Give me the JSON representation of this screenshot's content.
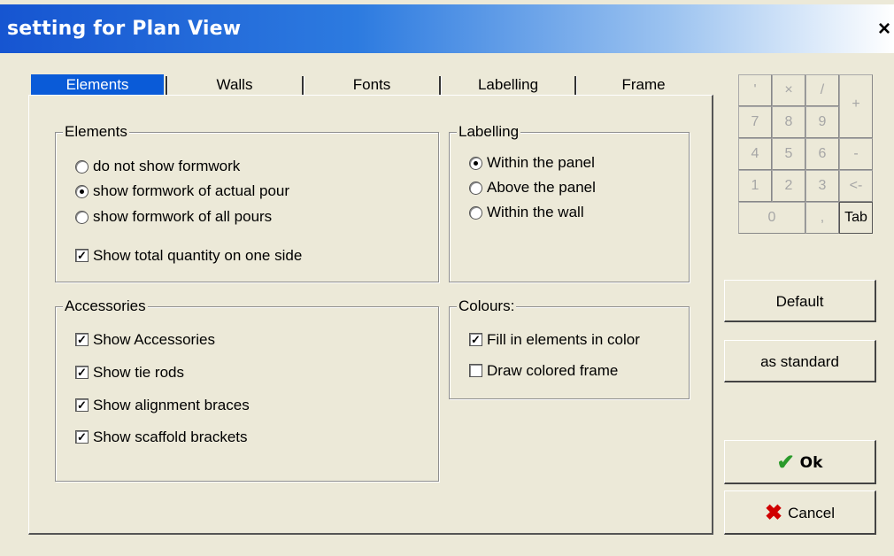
{
  "window": {
    "title": "setting for Plan View",
    "close_glyph": "×"
  },
  "tabs": [
    {
      "label": "Elements",
      "active": true
    },
    {
      "label": "Walls",
      "active": false
    },
    {
      "label": "Fonts",
      "active": false
    },
    {
      "label": "Labelling",
      "active": false
    },
    {
      "label": "Frame",
      "active": false
    }
  ],
  "elements_group": {
    "title": "Elements",
    "options": [
      {
        "label": "do not show formwork",
        "selected": false
      },
      {
        "label": "show formwork of actual pour",
        "selected": true
      },
      {
        "label": "show formwork of all pours",
        "selected": false
      }
    ],
    "checkbox": {
      "label": "Show total quantity on one side",
      "checked": true
    }
  },
  "labelling_group": {
    "title": "Labelling",
    "options": [
      {
        "label": "Within the panel",
        "selected": true
      },
      {
        "label": "Above the panel",
        "selected": false
      },
      {
        "label": "Within the wall",
        "selected": false
      }
    ]
  },
  "accessories_group": {
    "title": "Accessories",
    "items": [
      {
        "label": "Show Accessories",
        "checked": true
      },
      {
        "label": "Show tie rods",
        "checked": true
      },
      {
        "label": "Show alignment braces",
        "checked": true
      },
      {
        "label": "Show scaffold brackets",
        "checked": true
      }
    ]
  },
  "colours_group": {
    "title": "Colours:",
    "items": [
      {
        "label": "Fill in elements in color",
        "checked": true
      },
      {
        "label": "Draw colored frame",
        "checked": false
      }
    ]
  },
  "keypad": {
    "keys": [
      "'",
      "×",
      "/",
      "+",
      "7",
      "8",
      "9",
      "4",
      "5",
      "6",
      "-",
      "1",
      "2",
      "3",
      "<-",
      "0",
      ",",
      "Tab"
    ]
  },
  "buttons": {
    "default": "Default",
    "as_standard": "as standard",
    "ok": "Ok",
    "cancel": "Cancel"
  },
  "colors": {
    "titlebar": "#1655d1",
    "active_tab": "#0a5bd8",
    "dialog_bg": "#ece9d8",
    "ok_icon": "#2a9a2a",
    "cancel_icon": "#d00000"
  }
}
